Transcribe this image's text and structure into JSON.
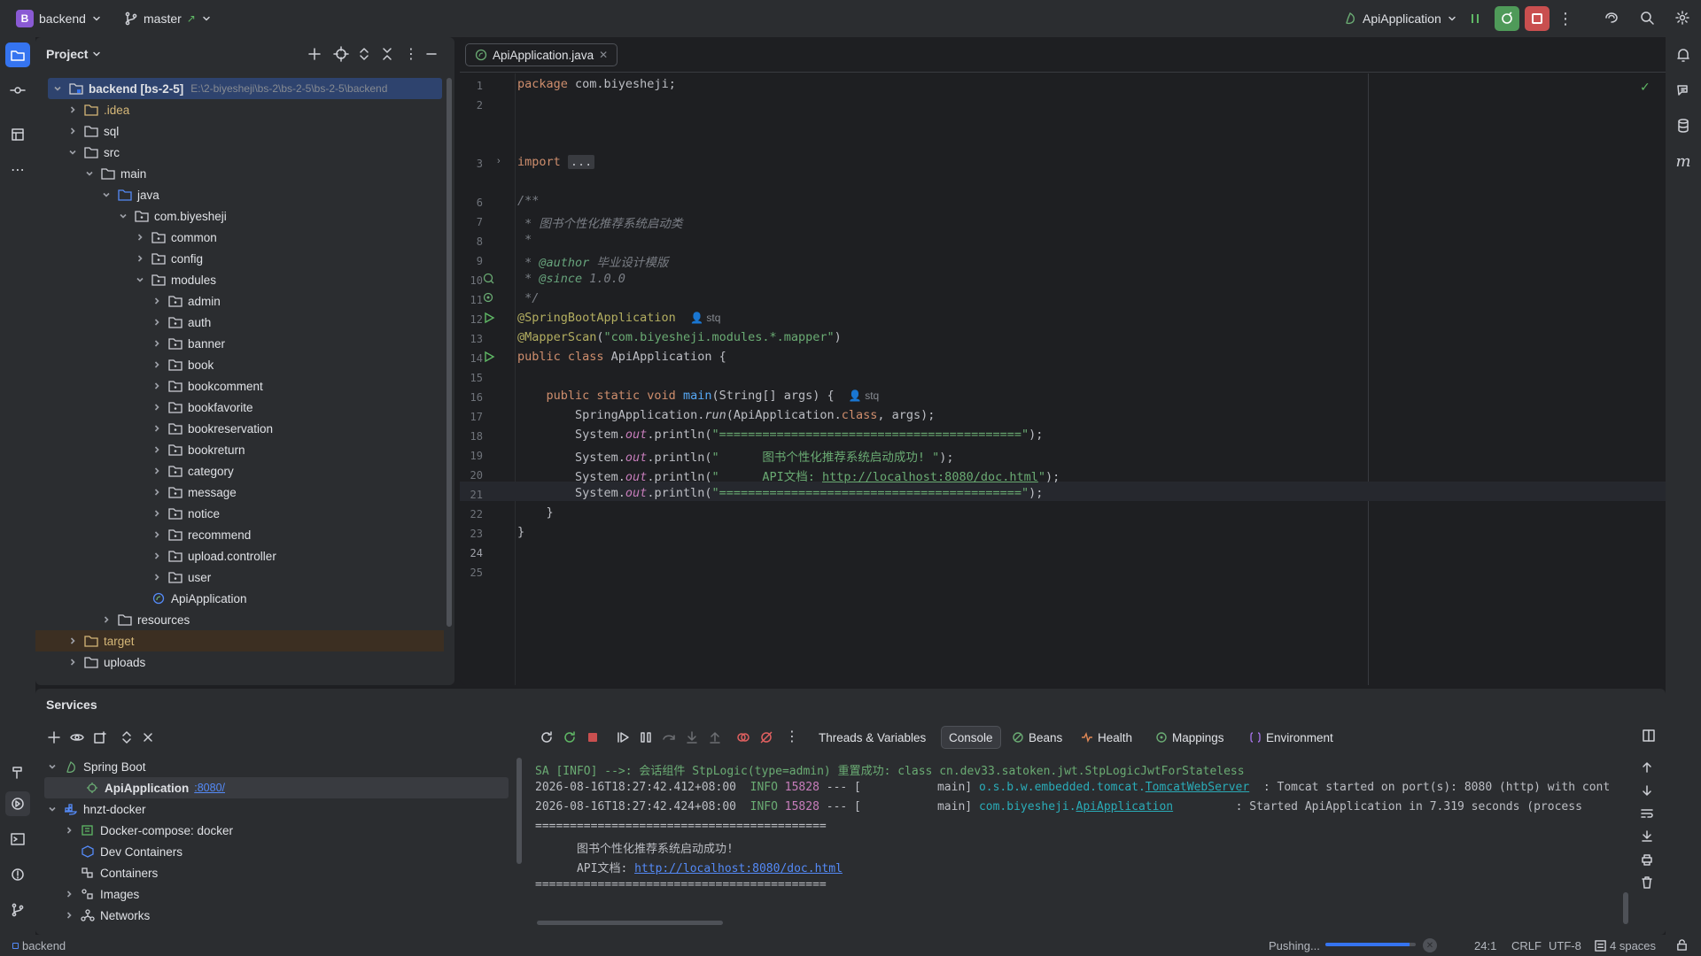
{
  "titlebar": {
    "project_badge": "B",
    "project_name": "backend",
    "branch": "master",
    "run_config": "ApiApplication"
  },
  "project_panel": {
    "title": "Project",
    "root_name": "backend [bs-2-5]",
    "root_path": "E:\\2-biyesheji\\bs-2\\bs-2-5\\bs-2-5\\backend",
    "items": [
      {
        "label": ".idea",
        "color": "#d5b778"
      },
      {
        "label": "sql"
      },
      {
        "label": "src"
      },
      {
        "label": "main"
      },
      {
        "label": "java"
      },
      {
        "label": "com.biyesheji"
      },
      {
        "label": "common"
      },
      {
        "label": "config"
      },
      {
        "label": "modules"
      },
      {
        "label": "admin"
      },
      {
        "label": "auth"
      },
      {
        "label": "banner"
      },
      {
        "label": "book"
      },
      {
        "label": "bookcomment"
      },
      {
        "label": "bookfavorite"
      },
      {
        "label": "bookreservation"
      },
      {
        "label": "bookreturn"
      },
      {
        "label": "category"
      },
      {
        "label": "message"
      },
      {
        "label": "notice"
      },
      {
        "label": "recommend"
      },
      {
        "label": "upload.controller"
      },
      {
        "label": "user"
      },
      {
        "label": "ApiApplication"
      },
      {
        "label": "resources"
      },
      {
        "label": "target",
        "color": "#d5b778"
      },
      {
        "label": "uploads"
      }
    ]
  },
  "editor": {
    "tab_label": "ApiApplication.java",
    "author_hint": "stq",
    "code_lines": [
      "package com.biyesheji;",
      "",
      "import ...",
      "/**",
      " * 图书个性化推荐系统启动类",
      " *",
      " * @author 毕业设计模版",
      " * @since 1.0.0",
      " */",
      "@SpringBootApplication",
      "@MapperScan(\"com.biyesheji.modules.*.mapper\")",
      "public class ApiApplication {",
      "",
      "    public static void main(String[] args) {",
      "        SpringApplication.run(ApiApplication.class, args);",
      "        System.out.println(\"==========================================\");",
      "        System.out.println(\"      图书个性化推荐系统启动成功! \");",
      "        System.out.println(\"      API文档: http://localhost:8080/doc.html\");",
      "        System.out.println(\"==========================================\");",
      "    }",
      "}",
      ""
    ],
    "line_numbers": [
      "1",
      "2",
      "3",
      "6",
      "7",
      "8",
      "9",
      "10",
      "11",
      "12",
      "13",
      "14",
      "15",
      "16",
      "17",
      "18",
      "19",
      "20",
      "21",
      "22",
      "23",
      "24",
      "25"
    ]
  },
  "services": {
    "title": "Services",
    "tree": [
      {
        "label": "Spring Boot"
      },
      {
        "label": "ApiApplication",
        "port": ":8080/"
      },
      {
        "label": "hnzt-docker"
      },
      {
        "label": "Docker-compose: docker"
      },
      {
        "label": "Dev Containers"
      },
      {
        "label": "Containers"
      },
      {
        "label": "Images"
      },
      {
        "label": "Networks"
      }
    ],
    "tabs": [
      "Threads & Variables",
      "Console",
      "Beans",
      "Health",
      "Mappings",
      "Environment"
    ],
    "console": {
      "line0": "SA [INFO] -->: 会话组件 StpLogic(type=admin) 重置成功: class cn.dev33.satoken.jwt.StpLogicJwtForStateless",
      "l1_ts": "2026-08-16T18:27:42.412+08:00",
      "l1_level": "INFO",
      "l1_pid": "15828",
      "l1_sep": "--- [",
      "l1_thread": "main]",
      "l1_logger_pkg": "o.s.b.w.embedded.tomcat.",
      "l1_logger_cls": "TomcatWebServer",
      "l1_msg": ": Tomcat started on port(s): 8080 (http) with cont",
      "l2_ts": "2026-08-16T18:27:42.424+08:00",
      "l2_level": "INFO",
      "l2_pid": "15828",
      "l2_sep": "--- [",
      "l2_thread": "main]",
      "l2_logger_pkg": "com.biyesheji.",
      "l2_logger_cls": "ApiApplication",
      "l2_msg": ": Started ApiApplication in 7.319 seconds (process",
      "sep": "==========================================",
      "success": "      图书个性化推荐系统启动成功!",
      "api_label": "      API文档: ",
      "api_url": "http://localhost:8080/doc.html"
    }
  },
  "statusbar": {
    "project": "backend",
    "progress_label": "Pushing...",
    "progress_fraction": 0.93,
    "position": "24:1",
    "line_sep": "CRLF",
    "encoding": "UTF-8",
    "indent": "4 spaces"
  }
}
